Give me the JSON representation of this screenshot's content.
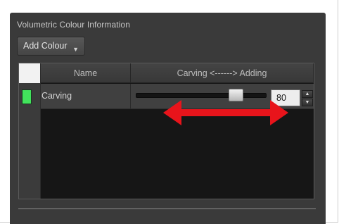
{
  "panel": {
    "section_title": "Volumetric Colour Information",
    "add_button_label": "Add Colour",
    "add_button_caret": "▼"
  },
  "table": {
    "columns": [
      "Name",
      "Carving <------> Adding"
    ],
    "rows": [
      {
        "swatch_color": "#42e35c",
        "name": "Carving",
        "slider_fraction": 0.8,
        "value": "80"
      }
    ]
  },
  "spin": {
    "up": "▲",
    "down": "▼"
  },
  "annotation": {
    "arrow_color": "#e8141b"
  },
  "colors": {
    "panel_bg": "#3a3a3a",
    "table_bg": "#161616",
    "accent": "#42e35c"
  }
}
